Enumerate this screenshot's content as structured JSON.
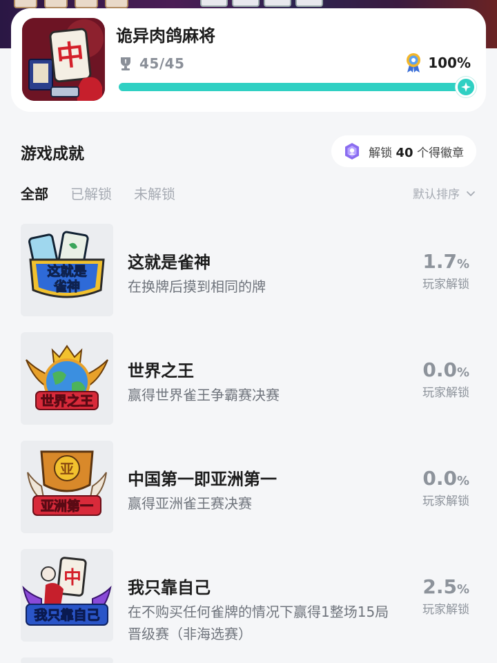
{
  "game": {
    "title": "诡异肉鸽麻将",
    "trophy_count": "45/45",
    "completion_text": "100%",
    "completion_value": 1.0,
    "icon_tile_char": "中"
  },
  "section": {
    "title": "游戏成就",
    "badge_prefix": "解锁",
    "badge_count": "40",
    "badge_suffix": "个得徽章"
  },
  "tabs": [
    {
      "label": "全部",
      "active": true
    },
    {
      "label": "已解锁",
      "active": false
    },
    {
      "label": "未解锁",
      "active": false
    }
  ],
  "sort_label": "默认排序",
  "achievements": [
    {
      "badge_text": "这就是雀神",
      "title": "这就是雀神",
      "description": "在换牌后摸到相同的牌",
      "rate": "1.7",
      "unit": "%",
      "rate_label": "玩家解锁"
    },
    {
      "badge_text": "世界之王",
      "title": "世界之王",
      "description": "赢得世界雀王争霸赛决赛",
      "rate": "0.0",
      "unit": "%",
      "rate_label": "玩家解锁"
    },
    {
      "badge_text": "亚洲第一",
      "badge_top": "亚",
      "title": "中国第一即亚洲第一",
      "description": "赢得亚洲雀王赛决赛",
      "rate": "0.0",
      "unit": "%",
      "rate_label": "玩家解锁"
    },
    {
      "badge_text": "我只靠自己",
      "badge_top": "中",
      "title": "我只靠自己",
      "description": "在不购买任何雀牌的情况下赢得1整场15局晋级赛（非海选赛）",
      "rate": "2.5",
      "unit": "%",
      "rate_label": "玩家解锁"
    }
  ],
  "colors": {
    "accent": "#2fd0c3",
    "background": "#f5f6f8",
    "rate_gray": "#8d939b"
  }
}
